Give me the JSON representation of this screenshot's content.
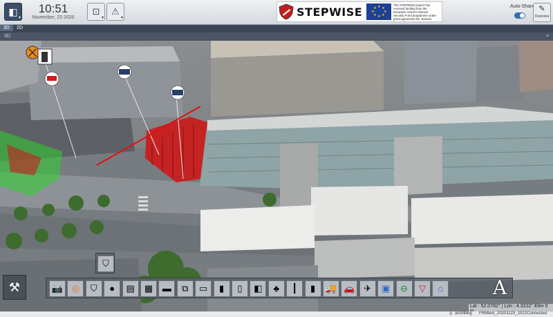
{
  "header": {
    "time": "10:51",
    "date": "November, 23 2020",
    "brand_name": "STEPWISE",
    "funding_text": "The STEPWISE project has received funding from the European Union's Internal Security Fund programme under grant agreement No. 815161.",
    "autoshare_label": "Auto-Share",
    "autoshare_on": true,
    "overview_label": "Overview"
  },
  "tabs": [
    {
      "label": "3D",
      "active": true
    },
    {
      "label": "2D",
      "active": false
    }
  ],
  "view": {
    "label": "3D",
    "close": "×"
  },
  "palette": {
    "popup_icon": "shield-icon",
    "items": [
      {
        "name": "camera-icon",
        "glyph": "📷"
      },
      {
        "name": "target-icon",
        "glyph": "◎"
      },
      {
        "name": "shield-icon",
        "glyph": "⛉"
      },
      {
        "name": "bag-icon",
        "glyph": "●"
      },
      {
        "name": "atm-icon",
        "glyph": "▤"
      },
      {
        "name": "barrier-icon",
        "glyph": "▦"
      },
      {
        "name": "bricks-icon",
        "glyph": "▬"
      },
      {
        "name": "gate-icon",
        "glyph": "⧉"
      },
      {
        "name": "bench-icon",
        "glyph": "▭"
      },
      {
        "name": "bollard-icon",
        "glyph": "▮"
      },
      {
        "name": "block-icon",
        "glyph": "▯"
      },
      {
        "name": "door-icon",
        "glyph": "◧"
      },
      {
        "name": "tree-icon",
        "glyph": "♣"
      },
      {
        "name": "lamp-post-icon",
        "glyph": "┃"
      },
      {
        "name": "traffic-light-icon",
        "glyph": "▮"
      },
      {
        "name": "truck-icon",
        "glyph": "🚚"
      },
      {
        "name": "car-icon",
        "glyph": "🚗"
      },
      {
        "name": "helicopter-icon",
        "glyph": "✈"
      },
      {
        "name": "hospital-icon",
        "glyph": "▣"
      },
      {
        "name": "no-entry-icon",
        "glyph": "⊖"
      },
      {
        "name": "police-sign-icon",
        "glyph": "▽"
      },
      {
        "name": "police-station-icon",
        "glyph": "⌂"
      }
    ],
    "text_tool": "A"
  },
  "coords": {
    "text": "Lat : 52.0782° | Lon : 4.3222° Elev 0 m"
  },
  "status": {
    "user": "aschilling",
    "scenario": "FRMtest_20201123_1022",
    "connection": "Connected"
  },
  "colors": {
    "header_bg": "#e3e6e9",
    "app_blue": "#3c4f66",
    "toggle_on": "#2f6db3",
    "crowd_red": "#c81e1e",
    "zone_green": "#2ed12e"
  }
}
